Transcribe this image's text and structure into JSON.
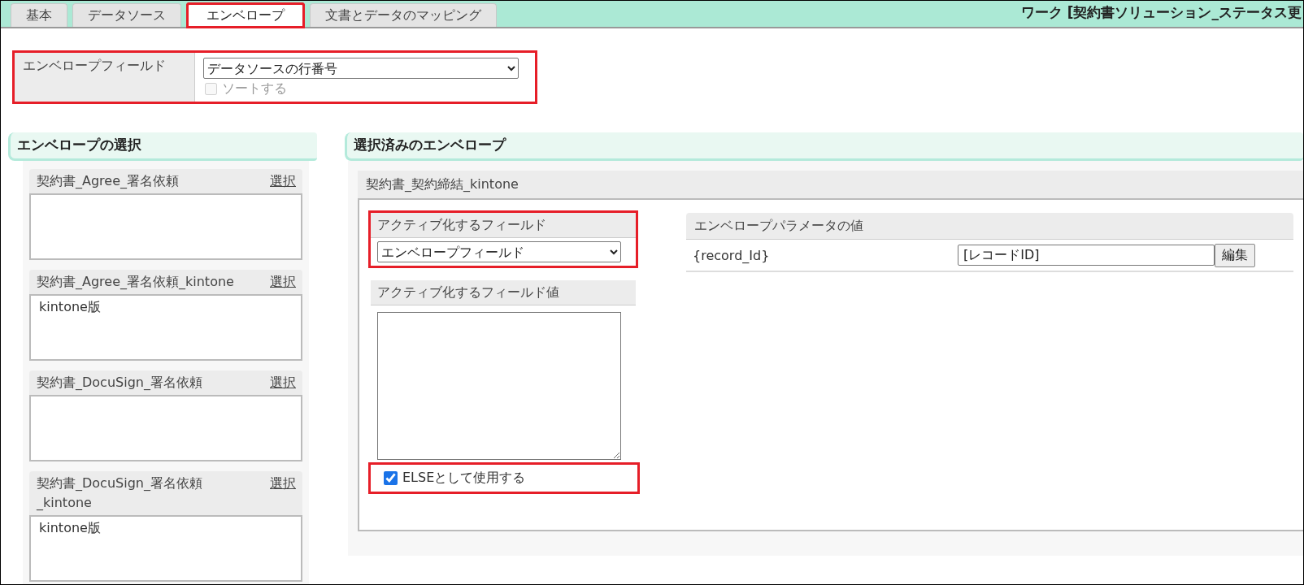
{
  "tabs": [
    {
      "label": "基本",
      "selected": false,
      "highlighted": false
    },
    {
      "label": "データソース",
      "selected": false,
      "highlighted": false
    },
    {
      "label": "エンベロープ",
      "selected": true,
      "highlighted": true
    },
    {
      "label": "文書とデータのマッピング",
      "selected": false,
      "highlighted": false
    }
  ],
  "work_title": "ワーク [契約書ソリューション_ステータス更",
  "envelope_field": {
    "label": "エンベロープフィールド",
    "value": "データソースの行番号",
    "highlighted": true,
    "sort": {
      "label": "ソートする",
      "checked": false,
      "disabled": true
    }
  },
  "envelope_selection": {
    "title": "エンベロープの選択",
    "envelopes": [
      {
        "name": "契約書_Agree_署名依頼",
        "link": "選択"
      },
      {
        "name": "契約書_Agree_署名依頼_kintone",
        "link": "選択",
        "description": "kintone版"
      },
      {
        "name": "契約書_DocuSign_署名依頼",
        "link": "選択"
      },
      {
        "name": "契約書_DocuSign_署名依頼_kintone",
        "link": "選択",
        "description": "kintone版"
      }
    ]
  },
  "selected_envelopes": {
    "title": "選択済みのエンベロープ",
    "envelope": {
      "name": "契約書_契約締結_kintone",
      "active_field": {
        "label": "アクティブ化するフィールド",
        "value": "エンベロープフィールド",
        "highlighted": true
      },
      "active_field_value": {
        "label": "アクティブ化するフィールド値"
      },
      "use_as_else": {
        "label": "ELSEとして使用する",
        "checked": true,
        "highlighted": true
      },
      "parameters": {
        "header": "エンベロープパラメータの値",
        "rows": [
          {
            "name": "{record_Id}",
            "value": "[レコードID]",
            "button": "編集"
          }
        ]
      }
    }
  }
}
